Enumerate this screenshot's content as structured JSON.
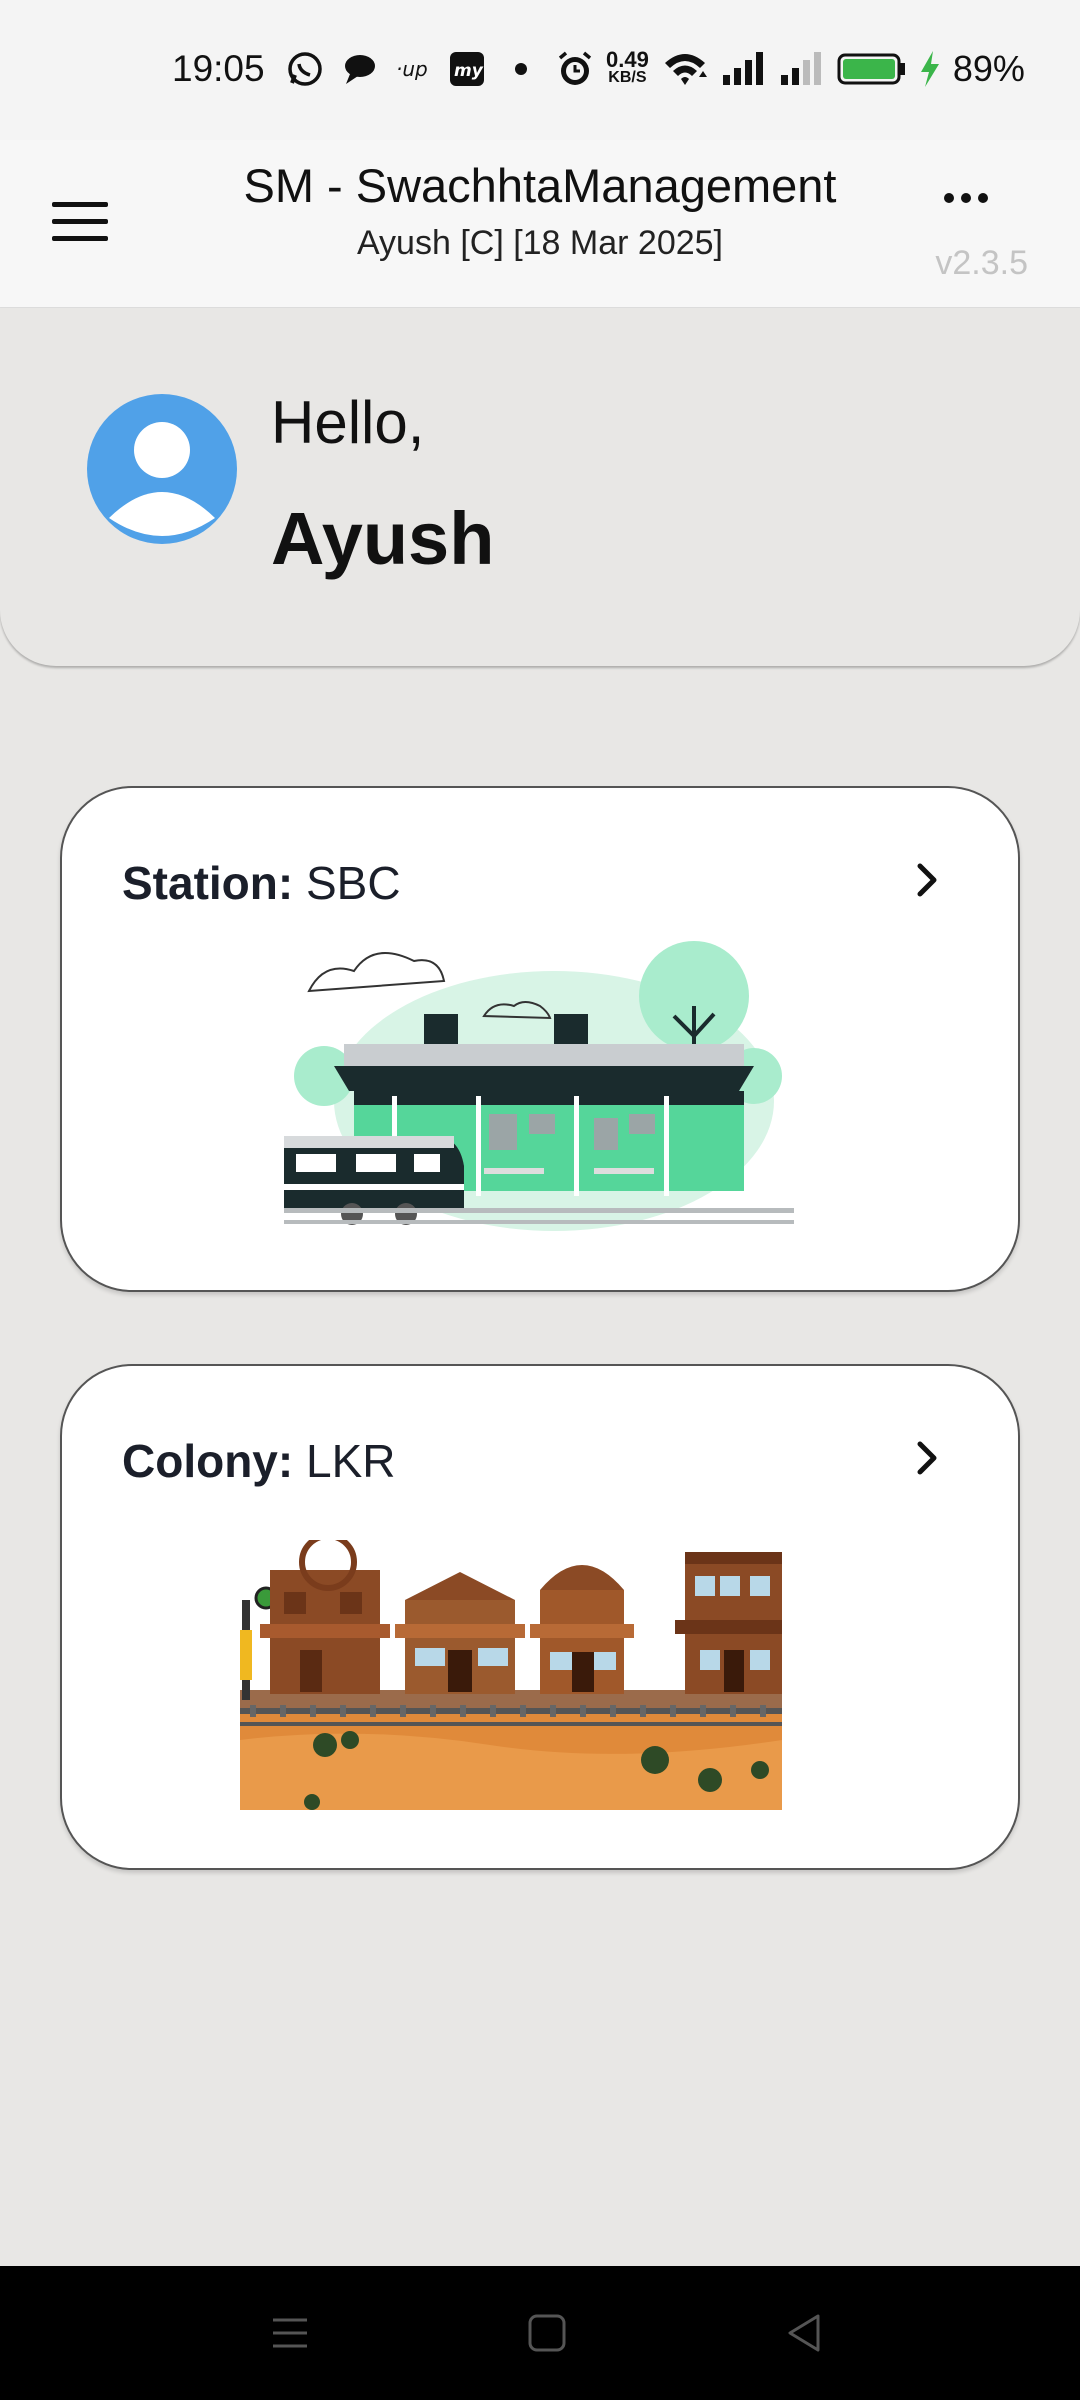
{
  "status_bar": {
    "time": "19:05",
    "net_speed": "0.49",
    "net_unit": "KB/S",
    "battery_pct": "89%",
    "icons": [
      "whatsapp-icon",
      "chat-icon",
      "up-icon",
      "my-app-icon",
      "dot-icon",
      "alarm-icon",
      "wifi-icon",
      "signal-icon",
      "signal-icon-2",
      "battery-icon",
      "charging-icon"
    ],
    "colors": {
      "battery_fill": "#3bb54a",
      "charging": "#3bb54a"
    }
  },
  "header": {
    "title": "SM - SwachhtaManagement",
    "subtitle": "Ayush [C]  [18 Mar 2025]",
    "version": "v2.3.5"
  },
  "greeting": {
    "hello": "Hello,",
    "name": "Ayush",
    "avatar_color": "#50a1e8"
  },
  "cards": [
    {
      "label_key": "Station:",
      "label_value": "SBC",
      "icon": "chevron-right-icon",
      "illustration": "railway-station-illustration"
    },
    {
      "label_key": "Colony:",
      "label_value": "LKR",
      "icon": "chevron-right-icon",
      "illustration": "wild-west-colony-illustration"
    }
  ],
  "nav_bar": {
    "buttons": [
      "recents-icon",
      "home-icon",
      "back-icon"
    ]
  }
}
